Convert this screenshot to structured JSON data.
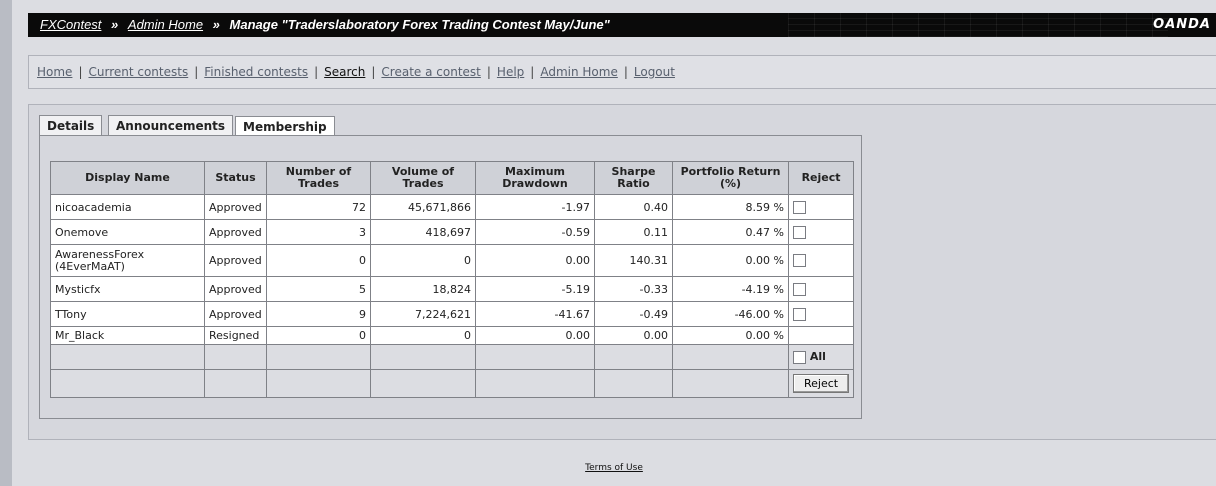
{
  "header": {
    "crumb1": "FXContest",
    "crumb2": "Admin Home",
    "crumb3": "Manage \"Traderslaboratory Forex Trading Contest May/June\"",
    "sep": "»",
    "brand": "OANDA"
  },
  "nav": {
    "items": [
      "Home",
      "Current contests",
      "Finished contests",
      "Search",
      "Create a contest",
      "Help",
      "Admin Home",
      "Logout"
    ],
    "sep": "|"
  },
  "tabs": [
    "Details",
    "Announcements",
    "Membership"
  ],
  "table": {
    "headers": [
      "Display Name",
      "Status",
      "Number of Trades",
      "Volume of Trades",
      "Maximum Drawdown",
      "Sharpe Ratio",
      "Portfolio Return (%)",
      "Reject"
    ],
    "rows": [
      [
        "nicoacademia",
        "Approved",
        "72",
        "45,671,866",
        "-1.97",
        "0.40",
        "8.59 %"
      ],
      [
        "Onemove",
        "Approved",
        "3",
        "418,697",
        "-0.59",
        "0.11",
        "0.47 %"
      ],
      [
        "AwarenessForex (4EverMaAT)",
        "Approved",
        "0",
        "0",
        "0.00",
        "140.31",
        "0.00 %"
      ],
      [
        "Mysticfx",
        "Approved",
        "5",
        "18,824",
        "-5.19",
        "-0.33",
        "-4.19 %"
      ],
      [
        "TTony",
        "Approved",
        "9",
        "7,224,621",
        "-41.67",
        "-0.49",
        "-46.00 %"
      ],
      [
        "Mr_Black",
        "Resigned",
        "0",
        "0",
        "0.00",
        "0.00",
        "0.00 %"
      ]
    ],
    "all_label": "All",
    "reject_button": "Reject"
  },
  "footer": {
    "terms": "Terms of Use"
  }
}
